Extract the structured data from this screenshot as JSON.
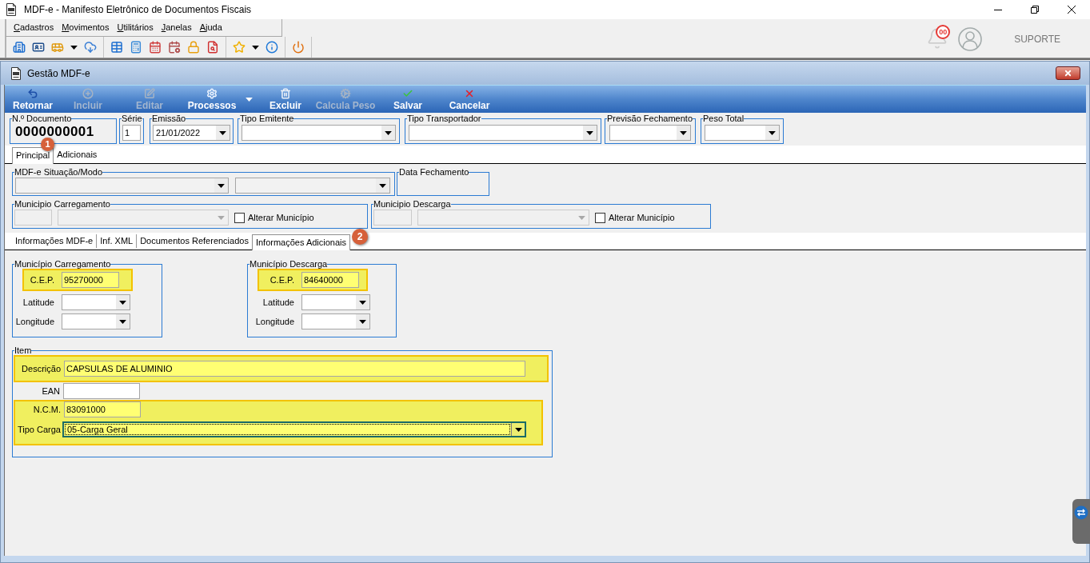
{
  "window": {
    "title": "MDF-e - Manifesto Eletrônico de Documentos Fiscais"
  },
  "menu": [
    "Cadastros",
    "Movimentos",
    "Utilitários",
    "Janelas",
    "Ajuda"
  ],
  "user_area": {
    "notification_count": "00",
    "user": "SUPORTE"
  },
  "child_window": {
    "title": "Gestão MDF-e",
    "toolbar": [
      {
        "label": "Retornar",
        "disabled": false,
        "dropdown": false
      },
      {
        "label": "Incluir",
        "disabled": true,
        "dropdown": false
      },
      {
        "label": "Editar",
        "disabled": true,
        "dropdown": false
      },
      {
        "label": "Processos",
        "disabled": false,
        "dropdown": true
      },
      {
        "label": "Excluir",
        "disabled": false,
        "dropdown": false
      },
      {
        "label": "Calcula Peso",
        "disabled": true,
        "dropdown": false
      },
      {
        "label": "Salvar",
        "disabled": false,
        "dropdown": false
      },
      {
        "label": "Cancelar",
        "disabled": false,
        "dropdown": false
      }
    ]
  },
  "header": {
    "marker": "1",
    "fields": [
      {
        "label": "N.º Documento",
        "kind": "display",
        "value": "0000000001"
      },
      {
        "label": "Série",
        "kind": "text",
        "value": "1"
      },
      {
        "label": "Emissão",
        "kind": "select",
        "value": "21/01/2022"
      },
      {
        "label": "Tipo Emitente",
        "kind": "select"
      },
      {
        "label": "Tipo Transportador",
        "kind": "select"
      },
      {
        "label": "Previsão Fechamento",
        "kind": "select"
      },
      {
        "label": "Peso Total",
        "kind": "select"
      }
    ]
  },
  "tabs": [
    {
      "label": "Principal",
      "selected": true
    },
    {
      "label": "Adicionais",
      "selected": false
    }
  ],
  "principal": {
    "situacao": {
      "label": "MDF-e Situação/Modo",
      "fields": [
        {
          "kind": "list",
          "disabled": false
        },
        {
          "kind": "list",
          "disabled": false
        }
      ]
    },
    "data_fechamento": {
      "label": "Data Fechamento"
    },
    "municipios": [
      {
        "label": "Municipio Carregamento",
        "fields": [
          {
            "kind": "text",
            "disabled": true
          },
          {
            "kind": "select",
            "disabled": true
          }
        ],
        "checkbox": {
          "label": "Alterar Município",
          "checked": false
        }
      },
      {
        "label": "Municipio Descarga",
        "fields": [
          {
            "kind": "text",
            "disabled": true
          },
          {
            "kind": "select",
            "disabled": true
          }
        ],
        "checkbox": {
          "label": "Alterar Município",
          "checked": false
        }
      }
    ]
  },
  "sub_tabs": {
    "marker": "2",
    "items": [
      {
        "label": "Informações MDF-e",
        "selected": false
      },
      {
        "label": "Inf. XML",
        "selected": false
      },
      {
        "label": "Documentos Referenciados",
        "selected": false
      },
      {
        "label": "Informações Adicionais",
        "selected": true
      }
    ]
  },
  "cep_groups": [
    {
      "label": "Município Carregamento",
      "fields": [
        {
          "label": "C.E.P.",
          "kind": "text",
          "value": "95270000",
          "highlighted": true
        },
        {
          "label": "Latitude",
          "kind": "select",
          "highlighted": false
        },
        {
          "label": "Longitude",
          "kind": "select",
          "highlighted": false
        }
      ]
    },
    {
      "label": "Município Descarga",
      "fields": [
        {
          "label": "C.E.P.",
          "kind": "text",
          "value": "84640000",
          "highlighted": true
        },
        {
          "label": "Latitude",
          "kind": "select",
          "highlighted": false
        },
        {
          "label": "Longitude",
          "kind": "select",
          "highlighted": false
        }
      ]
    }
  ],
  "item": {
    "label": "Item",
    "rows": [
      {
        "highlighted": true,
        "fields": [
          {
            "label": "Descrição",
            "kind": "text",
            "value": "CAPSULAS DE ALUMINIO",
            "focused": false
          }
        ]
      },
      {
        "highlighted": false,
        "fields": [
          {
            "label": "EAN",
            "kind": "text",
            "focused": false
          }
        ]
      },
      {
        "highlighted": true,
        "fields": [
          {
            "label": "N.C.M.",
            "kind": "text",
            "value": "83091000",
            "focused": false
          },
          {
            "label": "Tipo Carga",
            "kind": "select",
            "value": "05-Carga Geral",
            "focused": true
          }
        ]
      }
    ]
  }
}
